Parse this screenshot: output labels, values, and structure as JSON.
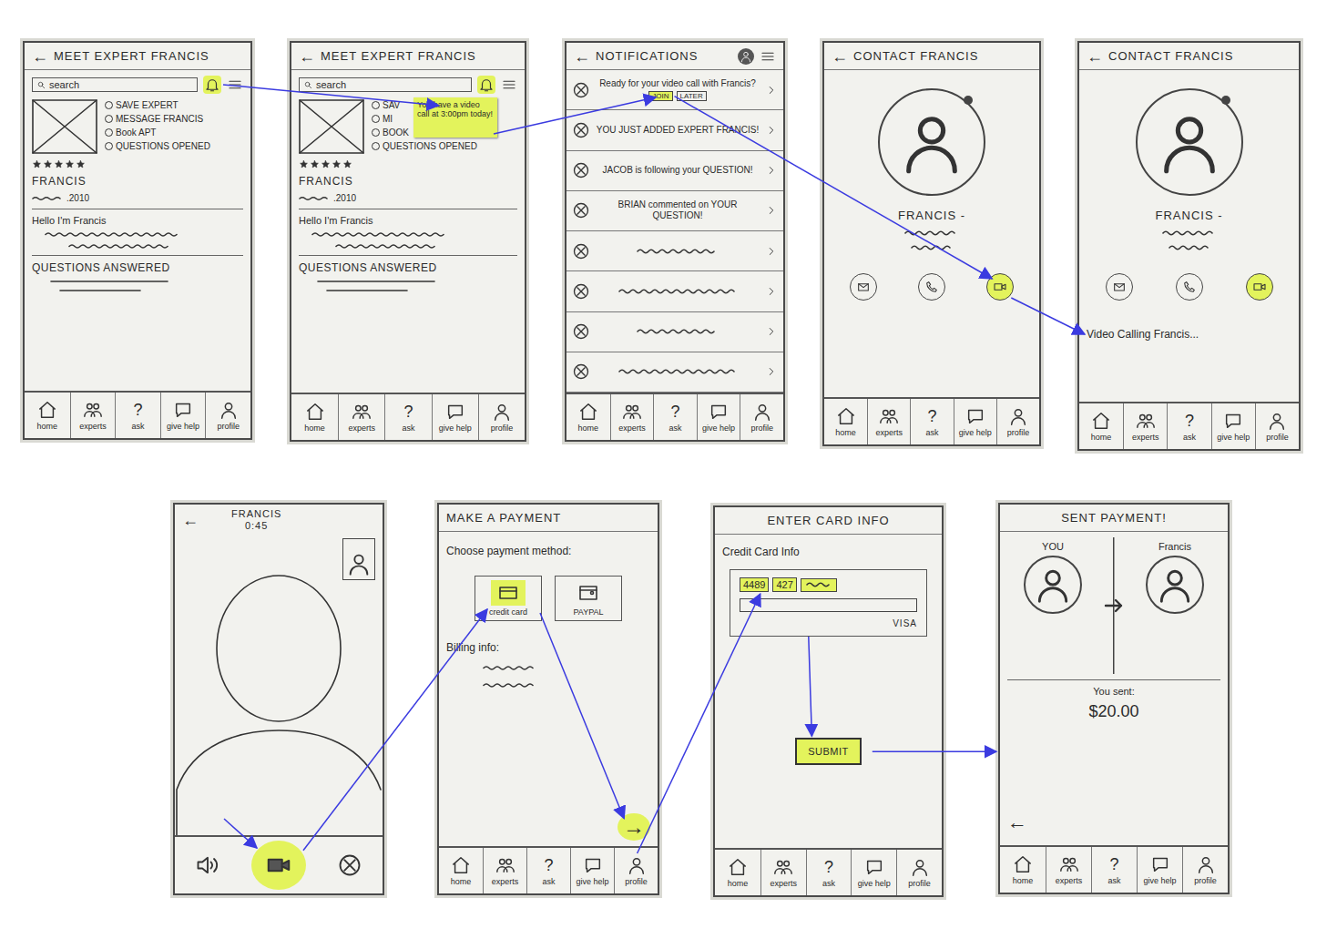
{
  "nav": [
    {
      "label": "home"
    },
    {
      "label": "experts"
    },
    {
      "label": "ask",
      "glyph": "?"
    },
    {
      "label": "give help"
    },
    {
      "label": "profile"
    }
  ],
  "screens": [
    {
      "kind": "profile",
      "back": "←",
      "title": "MEET EXPERT FRANCIS",
      "search": "search",
      "bell_highlighted": true,
      "actions": [
        {
          "label": "SAVE EXPERT"
        },
        {
          "label": "MESSAGE FRANCIS"
        },
        {
          "label": "Book APT"
        },
        {
          "label": "QUESTIONS OPENED"
        }
      ],
      "stars": 5,
      "name": "FRANCIS",
      "since": ".2010",
      "bio": "Hello I'm Francis",
      "section": "QUESTIONS ANSWERED"
    },
    {
      "kind": "profile",
      "back": "←",
      "title": "MEET EXPERT FRANCIS",
      "search": "search",
      "bell_highlighted": true,
      "actions": [
        {
          "label": "SAV"
        },
        {
          "label": "MI"
        },
        {
          "label": "BOOK"
        },
        {
          "label": "QUESTIONS OPENED"
        }
      ],
      "note": "You have a video call at 3:00pm today!",
      "stars": 5,
      "name": "FRANCIS",
      "since": ".2010",
      "bio": "Hello I'm Francis",
      "section": "QUESTIONS ANSWERED"
    },
    {
      "kind": "notifications",
      "back": "←",
      "title": "NOTIFICATIONS",
      "items": [
        {
          "kind": "text",
          "text": "Ready for your video call with Francis?",
          "buttons": [
            {
              "label": "JOIN",
              "selected": true
            },
            {
              "label": "LATER",
              "selected": false
            }
          ]
        },
        {
          "kind": "text",
          "text": "YOU JUST ADDED EXPERT FRANCIS!"
        },
        {
          "kind": "text",
          "text": "JACOB is following your QUESTION!"
        },
        {
          "kind": "text",
          "text": "BRIAN commented on YOUR QUESTION!"
        },
        {
          "kind": "squiggle"
        },
        {
          "kind": "squiggle"
        },
        {
          "kind": "squiggle"
        },
        {
          "kind": "squiggle"
        }
      ]
    },
    {
      "kind": "contact",
      "back": "←",
      "title": "CONTACT FRANCIS",
      "name": "FRANCIS -",
      "buttons": [
        {
          "kind": "message",
          "selected": false
        },
        {
          "kind": "call",
          "selected": false
        },
        {
          "kind": "video",
          "selected": true
        }
      ]
    },
    {
      "kind": "contact",
      "back": "←",
      "title": "CONTACT FRANCIS",
      "name": "FRANCIS -",
      "buttons": [
        {
          "kind": "message",
          "selected": false
        },
        {
          "kind": "call",
          "selected": false
        },
        {
          "kind": "video",
          "selected": true
        }
      ],
      "status": "Video Calling Francis..."
    },
    {
      "kind": "call",
      "back": "←",
      "title": "FRANCIS",
      "timer": "0:45",
      "controls": [
        {
          "kind": "speaker",
          "selected": false
        },
        {
          "kind": "video",
          "selected": true
        },
        {
          "kind": "end",
          "selected": false
        }
      ]
    },
    {
      "kind": "payment",
      "title": "MAKE A PAYMENT",
      "prompt": "Choose payment method:",
      "methods": [
        {
          "kind": "card",
          "label": "credit card",
          "selected": true
        },
        {
          "kind": "paypal",
          "label": "PAYPAL",
          "selected": false
        }
      ],
      "billing": "Billing info:",
      "next": {
        "label": "→",
        "selected": true
      }
    },
    {
      "kind": "card",
      "title": "ENTER CARD INFO",
      "label": "Credit Card Info",
      "fields": [
        {
          "kind": "text",
          "value": "4489",
          "selected": true
        },
        {
          "kind": "text",
          "value": "427",
          "selected": true
        },
        {
          "kind": "squiggle",
          "selected": true
        },
        {
          "kind": "wide",
          "selected": false
        }
      ],
      "brand": "VISA",
      "submit": {
        "label": "SUBMIT",
        "selected": true
      }
    },
    {
      "kind": "sent",
      "title": "SENT PAYMENT!",
      "from": "YOU",
      "to": "Francis",
      "caption": "You sent:",
      "amount": "$20.00",
      "back": "←"
    }
  ]
}
